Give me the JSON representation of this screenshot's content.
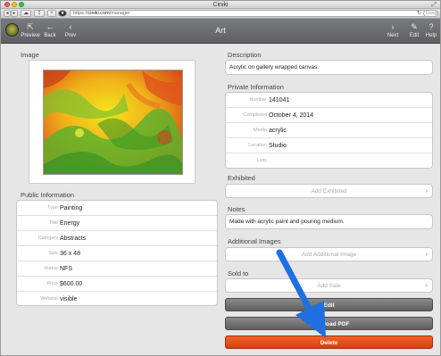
{
  "window": {
    "title": "Ciniki"
  },
  "browser": {
    "url_prefix": "https://",
    "url_host": "ciniki.com",
    "url_path": "/manager",
    "search_placeholder": "Google"
  },
  "nav": {
    "title": "Art",
    "preview_label": "Preview",
    "back_label": "Back",
    "prev_label": "Prev",
    "next_label": "Next",
    "edit_label": "Edit",
    "help_label": "Help"
  },
  "left": {
    "image_label": "Image",
    "public_info_label": "Public Information",
    "public_info": [
      {
        "key": "Type",
        "value": "Painting"
      },
      {
        "key": "Title",
        "value": "Energy"
      },
      {
        "key": "Category",
        "value": "Abstracts"
      },
      {
        "key": "Size",
        "value": "36 x 48"
      },
      {
        "key": "Status",
        "value": "NFS"
      },
      {
        "key": "Price",
        "value": "$600.00"
      },
      {
        "key": "Website",
        "value": "visible"
      }
    ]
  },
  "right": {
    "description_label": "Description",
    "description": "Acrylic on gallery wrapped canvas.",
    "private_info_label": "Private Information",
    "private_info": [
      {
        "key": "Number",
        "value": "141041"
      },
      {
        "key": "Completed",
        "value": "October 4, 2014"
      },
      {
        "key": "Media",
        "value": "acrylic"
      },
      {
        "key": "Location",
        "value": "Studio"
      },
      {
        "key": "Lists",
        "value": ""
      }
    ],
    "exhibited_label": "Exhibited",
    "add_exhibited": "Add Exhibited",
    "notes_label": "Notes",
    "notes": "Made with acrylic paint and pouring medium.",
    "additional_images_label": "Additional Images",
    "add_additional_image": "Add Additional Image",
    "sold_to_label": "Sold to",
    "add_sale": "Add Sale",
    "edit_button": "Edit",
    "download_button": "Download PDF",
    "delete_button": "Delete"
  },
  "colors": {
    "navbar": "#6b6c70",
    "delete": "#e2511c",
    "annotation_arrow": "#1f6fe0"
  }
}
